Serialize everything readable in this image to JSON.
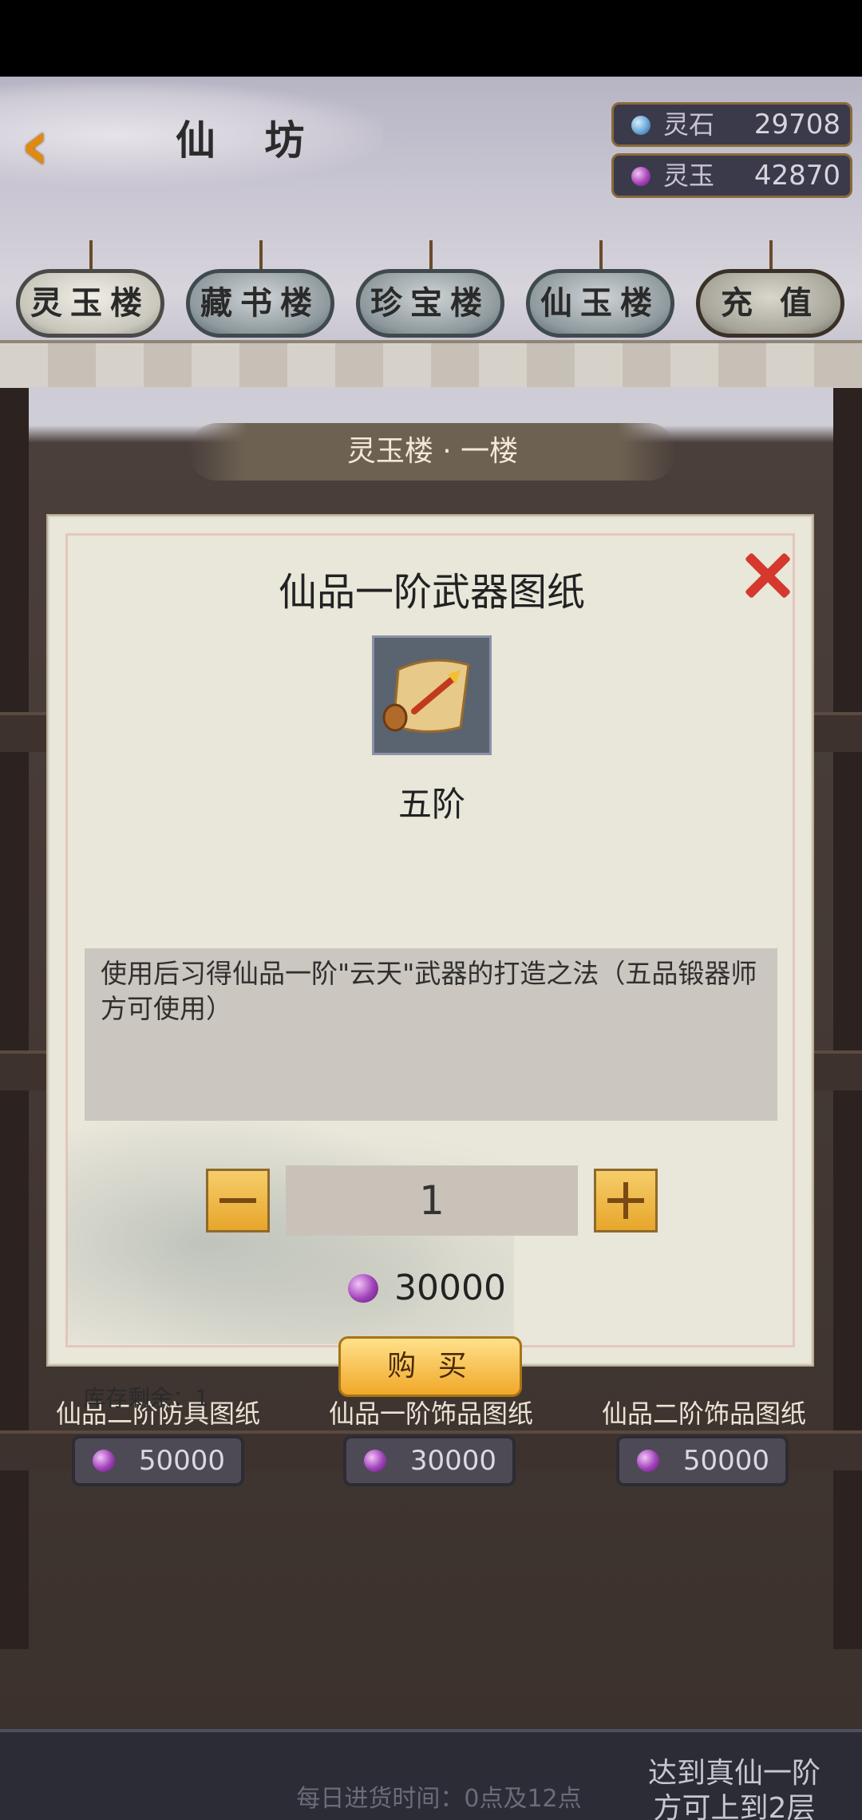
{
  "header": {
    "title": "仙 坊",
    "currencies": [
      {
        "label": "灵石",
        "amount": "29708",
        "color": "#6aa6d6"
      },
      {
        "label": "灵玉",
        "amount": "42870",
        "color": "#a744b8"
      }
    ]
  },
  "tabs": [
    {
      "label": "灵玉楼",
      "active": true
    },
    {
      "label": "藏书楼",
      "active": false
    },
    {
      "label": "珍宝楼",
      "active": false
    },
    {
      "label": "仙玉楼",
      "active": false
    },
    {
      "label": "充 值",
      "active": false
    }
  ],
  "floor_title": "灵玉楼 · 一楼",
  "dialog": {
    "item_name": "仙品一阶武器图纸",
    "icon": "scroll-icon",
    "tier": "五阶",
    "description": "使用后习得仙品一阶\"云天\"武器的打造之法（五品锻器师方可使用）",
    "quantity": "1",
    "price": "30000",
    "buy_label": "购 买",
    "stock_label": "库存剩余：1"
  },
  "shelf_items": [
    {
      "name": "仙品二阶防具图纸",
      "price": "50000"
    },
    {
      "name": "仙品一阶饰品图纸",
      "price": "30000"
    },
    {
      "name": "仙品二阶饰品图纸",
      "price": "50000"
    }
  ],
  "footer": {
    "restock_text": "每日进货时间：0点及12点",
    "floor_note_line1": "达到真仙一阶",
    "floor_note_line2": "方可上到2层"
  }
}
